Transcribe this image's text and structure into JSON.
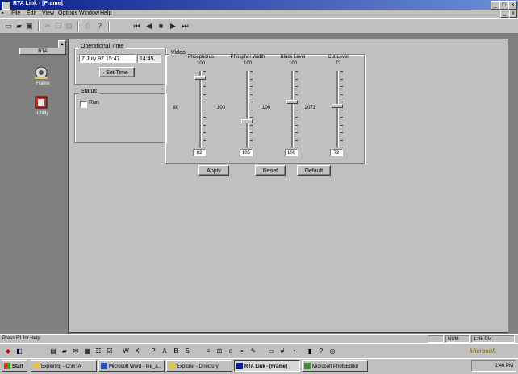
{
  "window": {
    "title": "RTA Link - [Frame]"
  },
  "menu": {
    "items": [
      "File",
      "Edit",
      "View",
      "Options",
      "Window",
      "Help"
    ],
    "doc_min": "_",
    "doc_close": "x"
  },
  "toolbar": {
    "new_icon": "new-document-icon",
    "open_icon": "open-folder-icon",
    "save_icon": "save-disk-icon",
    "cut_icon": "cut-icon",
    "copy_icon": "copy-icon",
    "paste_icon": "paste-icon",
    "print_icon": "print-icon",
    "help_icon": "help-icon",
    "first_icon": "first-frame-icon",
    "prev_icon": "previous-frame-icon",
    "stop_icon": "stop-icon",
    "play_icon": "play-icon",
    "last_icon": "last-frame-icon"
  },
  "leftbar": {
    "group_label": "RTA",
    "items": [
      {
        "label": "Frame",
        "icon": "frame-grabber-icon"
      },
      {
        "label": "Utility",
        "icon": "utility-icon"
      }
    ]
  },
  "dialog": {
    "operational_title": "Operational Time",
    "date_value": "7 July 97  15:47",
    "time_value": "14:45",
    "set_time_label": "Set Time",
    "status_title": "Status",
    "status_checkbox_label": "Run",
    "video_title": "Video",
    "sliders": [
      {
        "name": "Phosphorus",
        "max": "100",
        "min": "80",
        "value": "82",
        "level": 0.92
      },
      {
        "name": "Phosphor Width",
        "max": "100",
        "min": "100",
        "value": "105",
        "level": 0.35
      },
      {
        "name": "Black Level",
        "max": "100",
        "min": "100",
        "value": "100",
        "level": 0.6
      },
      {
        "name": "Cut Level",
        "max": "72",
        "min": "2071",
        "value": "72",
        "level": 0.55
      }
    ],
    "apply_label": "Apply",
    "reset_label": "Reset",
    "default_label": "Default"
  },
  "statusbar": {
    "message": "Press F1 for Help",
    "cell_num": "NUM",
    "cell_clock": "1:46 PM"
  },
  "officebar": {
    "brand": "Microsoft"
  },
  "taskbar": {
    "start_label": "Start",
    "tasks": [
      "Exploring - C:\\RTA",
      "Microsoft Word - fee_a...",
      "Explorer - Directory",
      "RTA Link - [Frame]",
      "Microsoft PhotoEditor"
    ],
    "active_index": 3,
    "tray_time": "1:46 PM"
  },
  "colors": {
    "titlebar_start": "#0a1f8f",
    "titlebar_end": "#6c8fd8",
    "workspace": "#808080",
    "face": "#c0c0c0"
  }
}
